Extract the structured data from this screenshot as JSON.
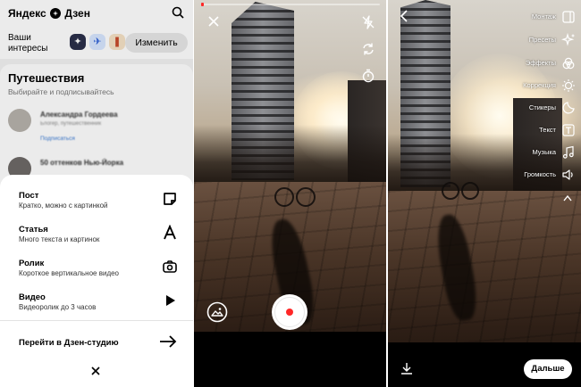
{
  "feed": {
    "logo": "Яндекс Дзен",
    "interests_label": "Ваши интересы",
    "change_button": "Изменить",
    "section_title": "Путешествия",
    "section_subtitle": "Выбирайте и подписывайтесь",
    "blogs": [
      {
        "name": "Александра Гордеева",
        "description": "Блогер, путешественник",
        "subscribe": "Подписаться"
      },
      {
        "name": "50 оттенков Нью-Йорка",
        "description": "",
        "subscribe": ""
      }
    ]
  },
  "create_sheet": {
    "items": [
      {
        "title": "Пост",
        "description": "Кратко, можно с картинкой",
        "icon": "sticky-note-icon"
      },
      {
        "title": "Статья",
        "description": "Много текста и картинок",
        "icon": "letter-a-icon"
      },
      {
        "title": "Ролик",
        "description": "Короткое вертикальное видео",
        "icon": "camera-icon"
      },
      {
        "title": "Видео",
        "description": "Видеоролик до 3 часов",
        "icon": "play-icon"
      }
    ],
    "studio_link": "Перейти в Дзен-студию",
    "close": "×"
  },
  "camera": {
    "progress": 0.0,
    "icons": [
      "close-icon",
      "flash-off-icon",
      "flip-camera-icon",
      "timer-icon",
      "gallery-icon",
      "record-button"
    ]
  },
  "editor": {
    "tools": [
      {
        "label": "Монтаж",
        "icon": "trim-icon"
      },
      {
        "label": "Пресеты",
        "icon": "sparkle-icon"
      },
      {
        "label": "Эффекты",
        "icon": "effects-icon"
      },
      {
        "label": "Коррекция",
        "icon": "correction-icon"
      },
      {
        "label": "Стикеры",
        "icon": "sticker-icon"
      },
      {
        "label": "Текст",
        "icon": "text-icon"
      },
      {
        "label": "Музыка",
        "icon": "music-icon"
      },
      {
        "label": "Громкость",
        "icon": "volume-icon"
      }
    ],
    "next_button": "Дальше",
    "accent": "#ff2727"
  }
}
